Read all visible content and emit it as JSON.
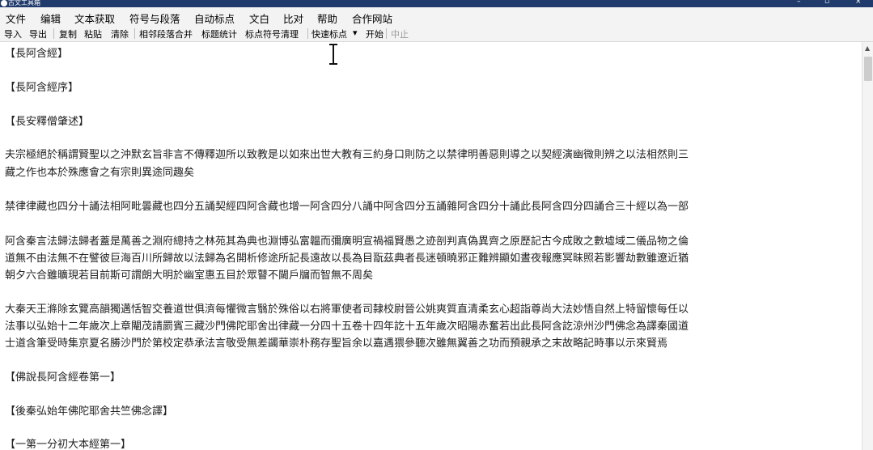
{
  "window": {
    "title": "古文工具箱",
    "controls": {
      "minimize": "–",
      "maximize": "▫",
      "close": "×"
    }
  },
  "menu": [
    "文件",
    "编辑",
    "文本获取",
    "符号与段落",
    "自动标点",
    "文白",
    "比对",
    "帮助",
    "合作网站"
  ],
  "toolbar": {
    "group1": [
      "导入",
      "导出"
    ],
    "group2": [
      "复制",
      "粘贴",
      "清除"
    ],
    "group3": [
      "相邻段落合并",
      "标题统计",
      "标点符号清理"
    ],
    "quick_punct": "快速标点",
    "dropdown_arrow": "▾",
    "start": "开始",
    "pause": "中止"
  },
  "editor": {
    "lines": [
      "【長阿含經】",
      "【長阿含經序】",
      "【長安釋僧肇述】",
      "夫宗極絕於稱謂賢聖以之沖默玄旨非言不傳釋迦所以致教是以如來出世大教有三約身口則防之以禁律明善惡則導之以契經演幽微則辨之以法相然則三",
      "藏之作也本於殊應會之有宗則異途同趣矣",
      "禁律律藏也四分十誦法相阿毗曇藏也四分五誦契經四阿含藏也增一阿含四分八誦中阿含四分五誦雜阿含四分十誦此長阿含四分四誦合三十經以為一部",
      "阿含秦言法歸法歸者蓋是萬善之淵府總持之林苑其為典也淵博弘富韞而彌廣明宣禍福賢愚之迹剖判真偽異齊之原歷記古今成敗之數墟域二儀品物之倫",
      "道無不由法無不在譬彼巨海百川所歸故以法歸為名開析修途所記長遠故以長為目翫茲典者長迷頓曉邪正難辨顯如晝夜報應冥昧照若影響劫數雖遼近猶",
      "朝夕六合雖曠現若目前斯可謂朗大明於幽室惠五目於眾瞽不闚戶牖而智無不周矣",
      "大秦天王滌除玄覽高韻獨邁恬智交養道世俱濟每懼微言翳於殊俗以右將軍使者司隸校尉晉公姚爽質直清柔玄心超詣尊尚大法妙悟自然上特留懷每任以",
      "法事以弘始十二年歲次上章閹茂請罽賓三藏沙門佛陀耶舍出律藏一分四十五卷十四年訖十五年歲次昭陽赤奮若出此長阿含訖涼州沙門佛念為譯秦國道",
      "士道含筆受時集京夏名勝沙門於第校定恭承法言敬受無差蠲華崇朴務存聖旨余以嘉遇猥參聽次雖無翼善之功而預親承之末故略記時事以示來賢焉",
      "【佛說長阿含經卷第一】",
      "【後秦弘始年佛陀耶舍共竺佛念譯】",
      "【一第一分初大本經第一】"
    ]
  }
}
